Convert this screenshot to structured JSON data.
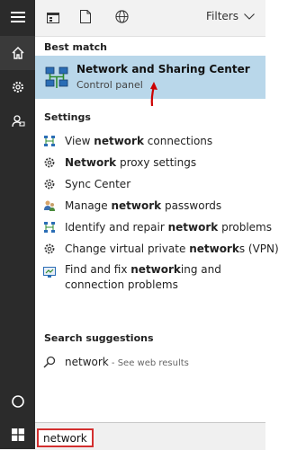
{
  "toolbar": {
    "filters_label": "Filters"
  },
  "best_match": {
    "heading": "Best match",
    "title": "Network and Sharing Center",
    "subtitle": "Control panel"
  },
  "settings": {
    "heading": "Settings",
    "items": [
      {
        "pre": "View ",
        "bold": "network",
        "post": " connections"
      },
      {
        "pre": "",
        "bold": "Network",
        "post": " proxy settings"
      },
      {
        "pre": "Sync Center",
        "bold": "",
        "post": ""
      },
      {
        "pre": "Manage ",
        "bold": "network",
        "post": " passwords"
      },
      {
        "pre": "Identify and repair ",
        "bold": "network",
        "post": " problems"
      },
      {
        "pre": "Change virtual private ",
        "bold": "network",
        "post": "s (VPN)"
      },
      {
        "pre": "Find and fix ",
        "bold": "network",
        "post": "ing and connection problems"
      }
    ]
  },
  "suggestions": {
    "heading": "Search suggestions",
    "query": "network",
    "hint": " - See web results"
  },
  "search": {
    "value": "network"
  },
  "colors": {
    "highlight": "#b9d7ea",
    "rail": "#2b2b2b",
    "accent_red": "#d32f2f"
  }
}
